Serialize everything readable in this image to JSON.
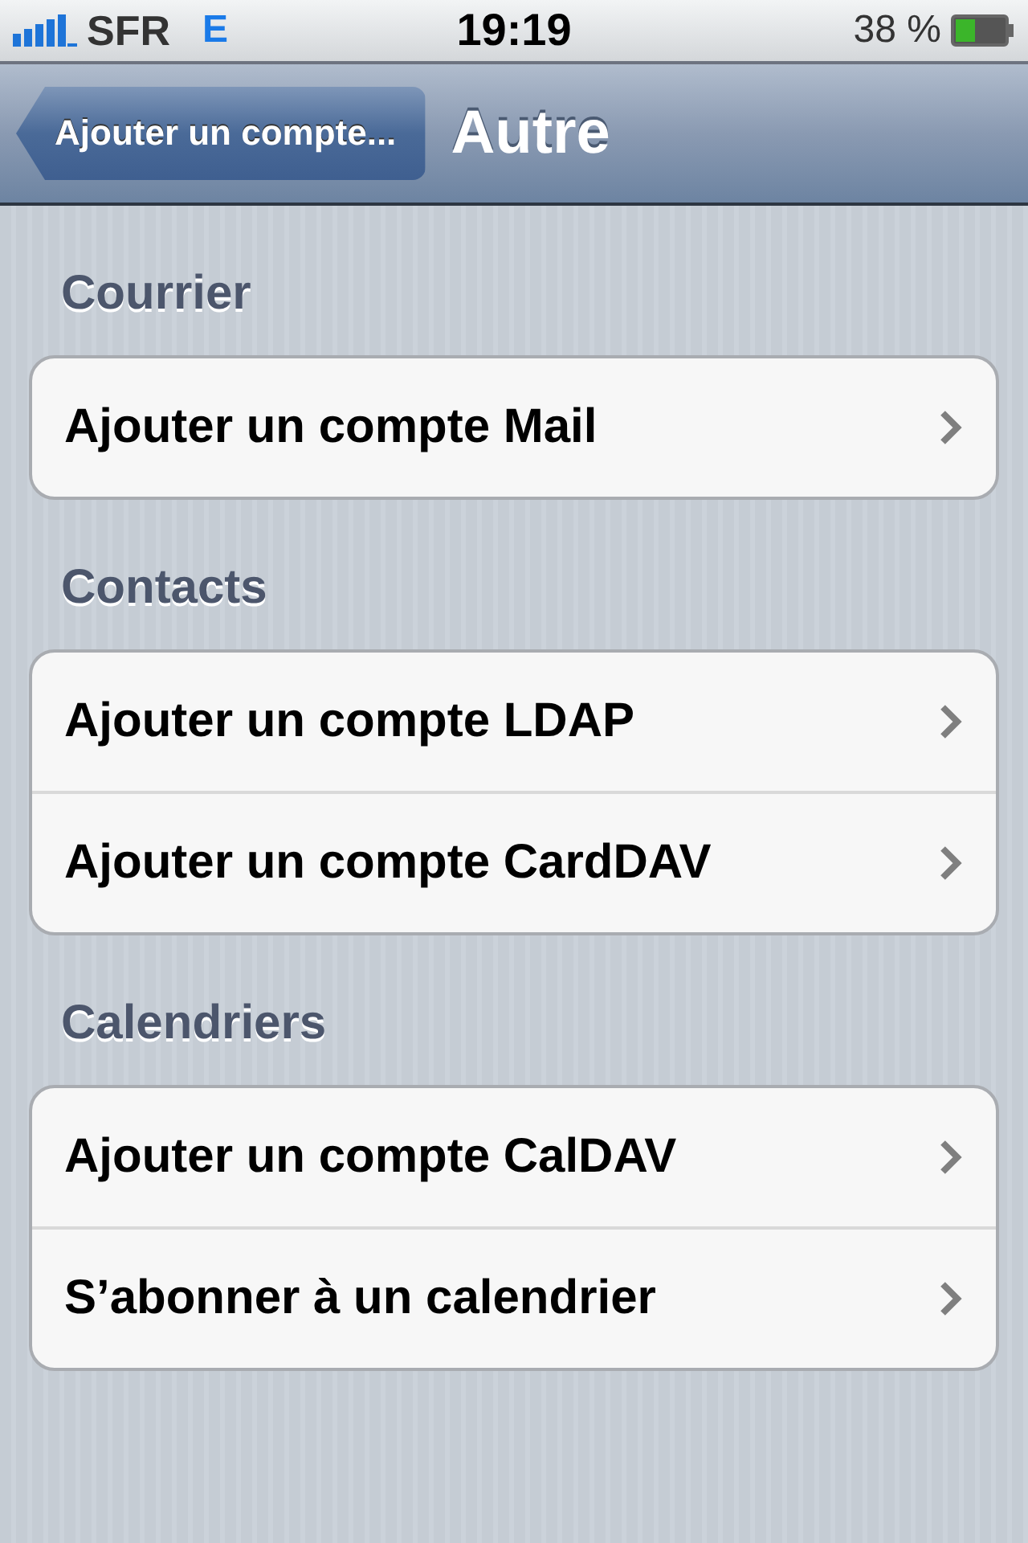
{
  "status_bar": {
    "carrier": "SFR",
    "network": "E",
    "time": "19:19",
    "battery": "38 %"
  },
  "nav_bar": {
    "back": "Ajouter un compte...",
    "title": "Autre"
  },
  "sections": [
    {
      "header": "Courrier",
      "rows": [
        {
          "label": "Ajouter un compte Mail"
        }
      ]
    },
    {
      "header": "Contacts",
      "rows": [
        {
          "label": "Ajouter un compte LDAP"
        },
        {
          "label": "Ajouter un compte CardDAV"
        }
      ]
    },
    {
      "header": "Calendriers",
      "rows": [
        {
          "label": "Ajouter un compte CalDAV"
        },
        {
          "label": "S’abonner à un calendrier"
        }
      ]
    }
  ]
}
